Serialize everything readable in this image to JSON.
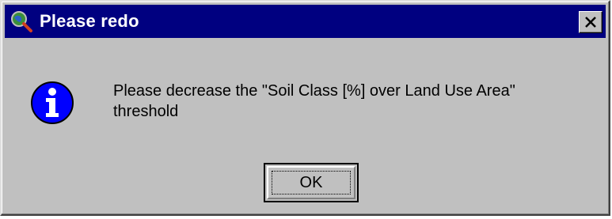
{
  "window": {
    "title": "Please redo",
    "app_icon": "globe-magnifier-icon",
    "close_icon": "close-icon"
  },
  "message": {
    "icon": "info-icon",
    "line1": "Please decrease the \"Soil Class [%] over Land Use Area\"",
    "line2": "threshold"
  },
  "buttons": {
    "ok_label": "OK"
  },
  "colors": {
    "titlebar": "#000080",
    "face": "#c0c0c0",
    "info_blue": "#0000ff"
  }
}
